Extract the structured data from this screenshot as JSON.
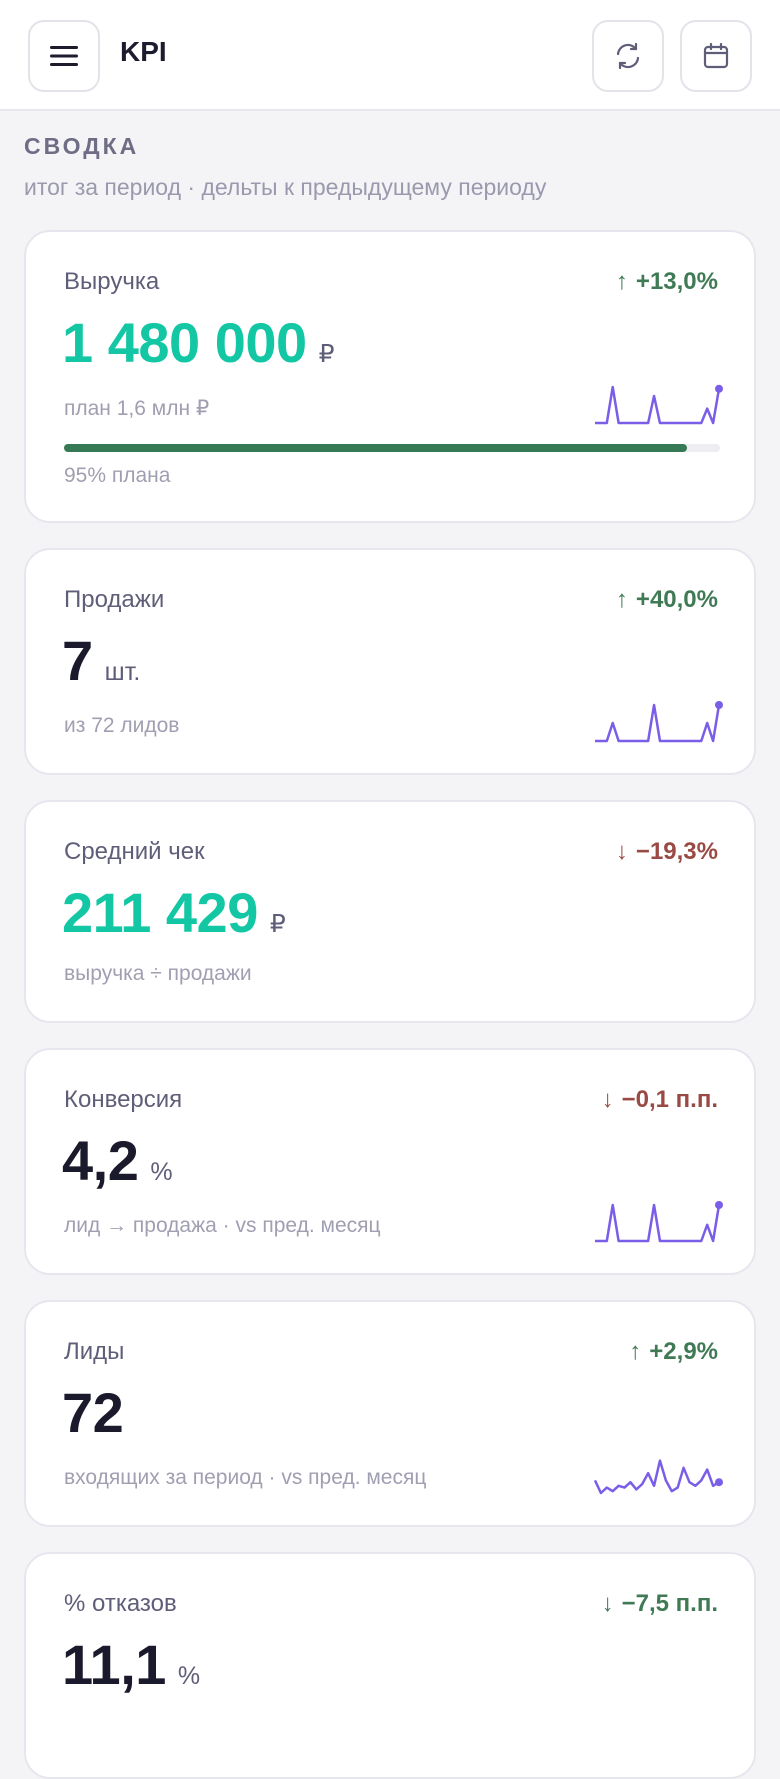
{
  "header": {
    "title": "KPI",
    "menu_icon": "hamburger-menu-icon",
    "refresh_icon": "refresh-icon",
    "calendar_icon": "calendar-icon"
  },
  "summary": {
    "title": "СВОДКА",
    "subtitle": "итог за период · дельты к предыдущему периоду"
  },
  "colors": {
    "accent_teal": "#14c7a4",
    "positive": "#3f7a55",
    "negative": "#9a4a45",
    "sparkline": "#7a5ee8",
    "progress": "#357a55"
  },
  "cards": [
    {
      "label": "Выручка",
      "delta": "+13,0%",
      "delta_dir": "up",
      "value": "1 480 000",
      "unit": "₽",
      "note": "план 1,6 млн ₽",
      "progress_fraction": 0.95,
      "progress_label": "95% плана",
      "sparkline": [
        0,
        0,
        0,
        1,
        0,
        0,
        0,
        0,
        0,
        0,
        0.75,
        0,
        0,
        0,
        0,
        0,
        0,
        0,
        0,
        0.4,
        0,
        0.95
      ]
    },
    {
      "label": "Продажи",
      "delta": "+40,0%",
      "delta_dir": "up",
      "value": "7",
      "unit": "шт.",
      "note": "из 72 лидов",
      "sparkline": [
        0,
        0,
        0,
        0.5,
        0,
        0,
        0,
        0,
        0,
        0,
        1,
        0,
        0,
        0,
        0,
        0,
        0,
        0,
        0,
        0.5,
        0,
        1
      ]
    },
    {
      "label": "Средний чек",
      "delta": "−19,3%",
      "delta_dir": "down",
      "value": "211 429",
      "unit": "₽",
      "note": "выручка ÷ продажи"
    },
    {
      "label": "Конверсия",
      "delta": "−0,1 п.п.",
      "delta_dir": "down",
      "value": "4,2",
      "unit": "%",
      "note": "лид → продажа · vs пред. месяц",
      "sparkline": [
        0,
        0,
        0,
        1,
        0,
        0,
        0,
        0,
        0,
        0,
        1,
        0,
        0,
        0,
        0,
        0,
        0,
        0,
        0,
        0.45,
        0,
        1
      ]
    },
    {
      "label": "Лиды",
      "delta": "+2,9%",
      "delta_dir": "up",
      "value": "72",
      "unit": "",
      "note": "входящих за период · vs пред. месяц",
      "sparkline": [
        0.35,
        0,
        0.15,
        0.05,
        0.2,
        0.15,
        0.3,
        0.1,
        0.25,
        0.55,
        0.2,
        0.9,
        0.35,
        0.05,
        0.15,
        0.7,
        0.3,
        0.2,
        0.35,
        0.65,
        0.2,
        0.3
      ]
    },
    {
      "label": "% отказов",
      "delta": "−7,5 п.п.",
      "delta_dir": "up",
      "value": "11,1",
      "unit": "%",
      "note": ""
    }
  ]
}
